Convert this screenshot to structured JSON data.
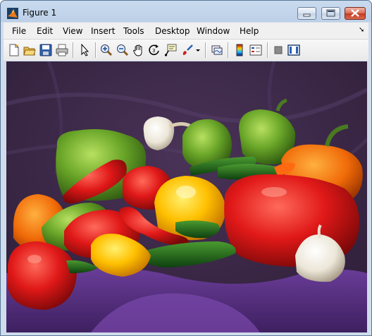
{
  "window": {
    "title": "Figure 1"
  },
  "menu": [
    "File",
    "Edit",
    "View",
    "Insert",
    "Tools",
    "Desktop",
    "Window",
    "Help"
  ],
  "toolbar_icons": [
    "new-figure-icon",
    "open-file-icon",
    "save-icon",
    "print-icon",
    "pointer-icon",
    "zoom-in-icon",
    "zoom-out-icon",
    "pan-icon",
    "rotate-3d-icon",
    "data-cursor-icon",
    "brush-icon",
    "brush-dropdown-icon",
    "link-plot-icon",
    "colorbar-icon",
    "legend-icon",
    "hide-plot-tools-icon",
    "show-plot-tools-icon"
  ],
  "colors": {
    "background_cloth": "#3c2948",
    "accent": "#1f5fa8"
  }
}
